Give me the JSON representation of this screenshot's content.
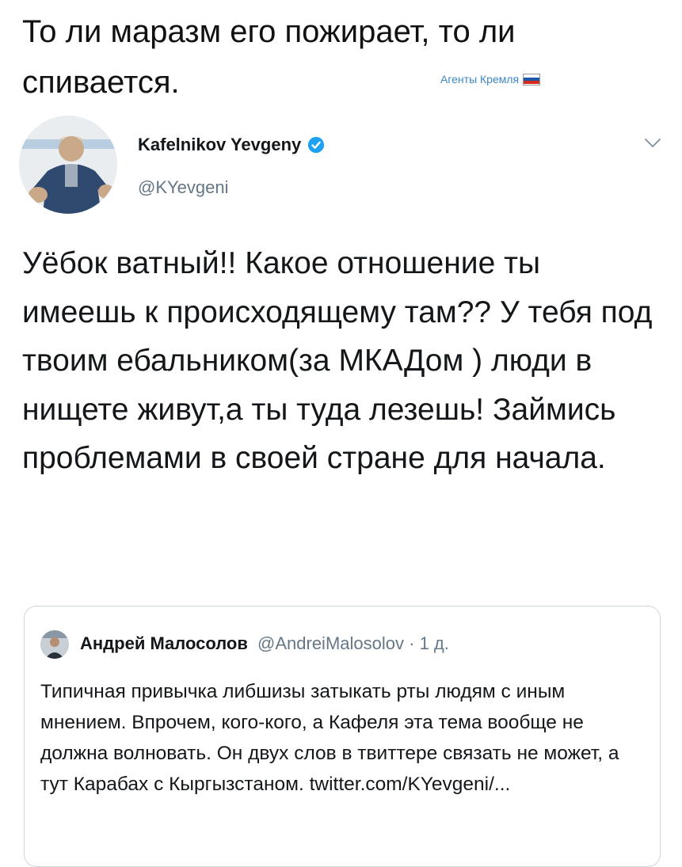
{
  "caption": {
    "text": "То ли маразм его пожирает, то ли спивается."
  },
  "watermark": {
    "text": "Агенты Кремля",
    "flag_colors": [
      "#ffffff",
      "#1c57a5",
      "#d52b1e"
    ]
  },
  "tweet": {
    "author_name": "Kafelnikov Yevgeny",
    "handle": "@KYevgeni",
    "verified": true,
    "icons": [
      "avatar",
      "verified-badge-icon",
      "chevron-down-icon"
    ],
    "text": "Уёбок ватный!! Какое отношение ты имеешь к происходящему там?? У тебя под твоим ебальником(за МКАДом ) люди в нищете живут,а ты туда лезешь! Займись проблемами в своей стране для начала."
  },
  "quoted_tweet": {
    "author_name": "Андрей Малосолов",
    "handle": "@AndreiMalosolov",
    "time": "· 1 д.",
    "text": "Типичная привычка либшизы затыкать рты людям с иным мнением. Впрочем,  кого-кого, а Кафеля эта тема вообще не должна волновать. Он двух слов в твиттере связать не может, а тут Карабах с Кыргызстаном. twitter.com/KYevgeni/..."
  },
  "colors": {
    "text": "#14171a",
    "secondary": "#657786",
    "verified_blue": "#1da1f2",
    "border": "#ccd6dd",
    "watermark": "#3b86c8"
  }
}
